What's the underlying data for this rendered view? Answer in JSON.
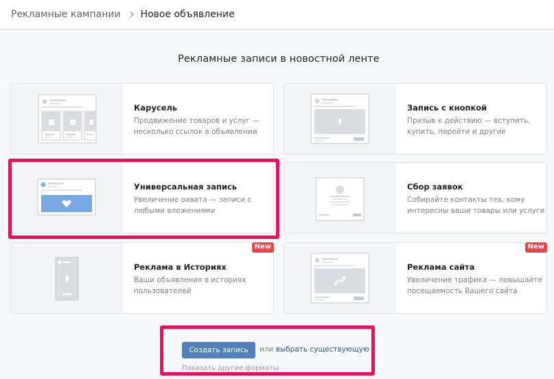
{
  "breadcrumb": {
    "parent": "Рекламные кампании",
    "current": "Новое объявление"
  },
  "section_title": "Рекламные записи в новостной ленте",
  "badge_new": "New",
  "cards": [
    {
      "title": "Карусель",
      "description": "Продвижение товаров и услуг — несколько ссылок в объявлении"
    },
    {
      "title": "Запись с кнопкой",
      "description": "Призыв к действию — вступить, купить, перейти и другие"
    },
    {
      "title": "Универсальная запись",
      "description": "Увеличение охвата — записи с любыми вложениями"
    },
    {
      "title": "Сбор заявок",
      "description": "Собирайте контакты тех, кому интересны ваши товары или услуги"
    },
    {
      "title": "Реклама в Историях",
      "description": "Ваши объявления в историях пользователей"
    },
    {
      "title": "Реклама сайта",
      "description": "Увеличение трафика — повышайте посещаемость Вашего сайта"
    }
  ],
  "actions": {
    "create_label": "Создать запись",
    "or_text": "или",
    "choose_existing": "выбрать существующую",
    "other_formats": "Показать другие форматы"
  },
  "colors": {
    "accent": "#5181b8",
    "highlight": "#e8115f",
    "badge": "#e64646",
    "link": "#2a5885"
  },
  "icons": [
    "chevron-right-icon",
    "carousel-preview-icon",
    "button-post-preview-icon",
    "universal-post-preview-icon",
    "lead-form-preview-icon",
    "stories-preview-icon",
    "website-ad-preview-icon"
  ]
}
